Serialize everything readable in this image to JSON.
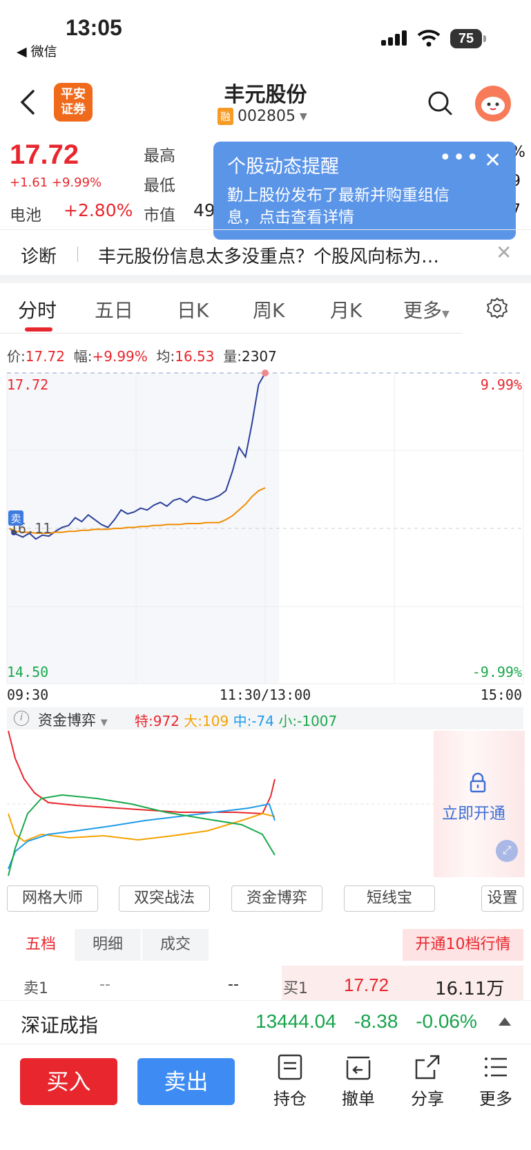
{
  "status_bar": {
    "time": "13:05",
    "back_app": "◀ 微信",
    "battery": "75"
  },
  "header": {
    "logo": "平安\n证券",
    "stock_name": "丰元股份",
    "rong_badge": "融",
    "stock_code": "002805"
  },
  "quote": {
    "price": "17.72",
    "change": "+1.61 +9.99%",
    "high_label": "最高",
    "low_label": "最低",
    "sector_label": "电池",
    "sector_change": "+2.80%",
    "mktcap_label": "市值",
    "mktcap_partial": "49",
    "clipped_right": [
      "%",
      "9",
      "7"
    ]
  },
  "popup": {
    "title": "个股动态提醒",
    "dots": "•••",
    "close": "✕",
    "text": "勤上股份发布了最新并购重组信息，点击查看详情"
  },
  "diagnose": {
    "label": "诊断",
    "text": "丰元股份信息太多没重点？个股风向标为…",
    "close": "✕"
  },
  "tabs": {
    "items": [
      "分时",
      "五日",
      "日K",
      "周K",
      "月K",
      "更多"
    ],
    "active": 0
  },
  "price_info": {
    "price_label": "价:",
    "price": "17.72",
    "amp_label": "幅:",
    "amp": "+9.99%",
    "avg_label": "均:",
    "avg": "16.53",
    "vol_label": "量:",
    "vol": "2307"
  },
  "chart_data": {
    "type": "line",
    "title": "",
    "y_top_label": "17.72",
    "y_mid_label": "16.11",
    "y_bottom_label": "14.50",
    "pct_top_label": "9.99%",
    "pct_bottom_label": "-9.99%",
    "x_labels": [
      "09:30",
      "11:30/13:00",
      "15:00"
    ],
    "sell_marker": "卖",
    "ylim": [
      14.5,
      17.72
    ],
    "series": [
      {
        "name": "价",
        "color": "#2a3f9a",
        "values": [
          16.11,
          16.05,
          16.02,
          16.06,
          16.0,
          16.04,
          16.03,
          16.08,
          16.12,
          16.14,
          16.22,
          16.18,
          16.25,
          16.2,
          16.15,
          16.12,
          16.2,
          16.3,
          16.26,
          16.28,
          16.32,
          16.3,
          16.35,
          16.38,
          16.34,
          16.4,
          16.42,
          16.38,
          16.44,
          16.42,
          16.4,
          16.42,
          16.45,
          16.5,
          16.7,
          16.95,
          16.85,
          17.2,
          17.6,
          17.72
        ]
      },
      {
        "name": "均",
        "color": "#f08c00",
        "values": [
          16.11,
          16.08,
          16.07,
          16.07,
          16.06,
          16.06,
          16.06,
          16.07,
          16.07,
          16.08,
          16.08,
          16.09,
          16.09,
          16.1,
          16.1,
          16.1,
          16.11,
          16.11,
          16.12,
          16.12,
          16.13,
          16.13,
          16.14,
          16.14,
          16.15,
          16.15,
          16.15,
          16.16,
          16.16,
          16.16,
          16.17,
          16.17,
          16.17,
          16.2,
          16.24,
          16.3,
          16.36,
          16.44,
          16.5,
          16.53
        ]
      }
    ]
  },
  "fund_game": {
    "title": "资金博弈",
    "info": "i",
    "te_label": "特:",
    "te": "972",
    "da_label": "大:",
    "da": "109",
    "zhong_label": "中:",
    "zhong": "-74",
    "xiao_label": "小:",
    "xiao": "-1007",
    "lock_text": "立即开通",
    "colors": {
      "te": "#e8262d",
      "da": "#f5a200",
      "zhong": "#1e9be8",
      "xiao": "#18a84a"
    }
  },
  "tools": [
    "网格大师",
    "双突战法",
    "资金博弈",
    "短线宝",
    "设置"
  ],
  "order_book": {
    "tabs": [
      "五档",
      "明细",
      "成交"
    ],
    "open_btn": "开通10档行情",
    "sell1_label": "卖1",
    "sell1_price": "--",
    "sell1_vol": "--",
    "buy1_label": "买1",
    "buy1_price": "17.72",
    "buy1_vol": "16.11万"
  },
  "index_bar": {
    "name": "深证成指",
    "value": "13444.04",
    "change": "-8.38",
    "pct": "-0.06%"
  },
  "bottom": {
    "buy": "买入",
    "sell": "卖出",
    "items": [
      "持仓",
      "撤单",
      "分享",
      "更多"
    ]
  }
}
